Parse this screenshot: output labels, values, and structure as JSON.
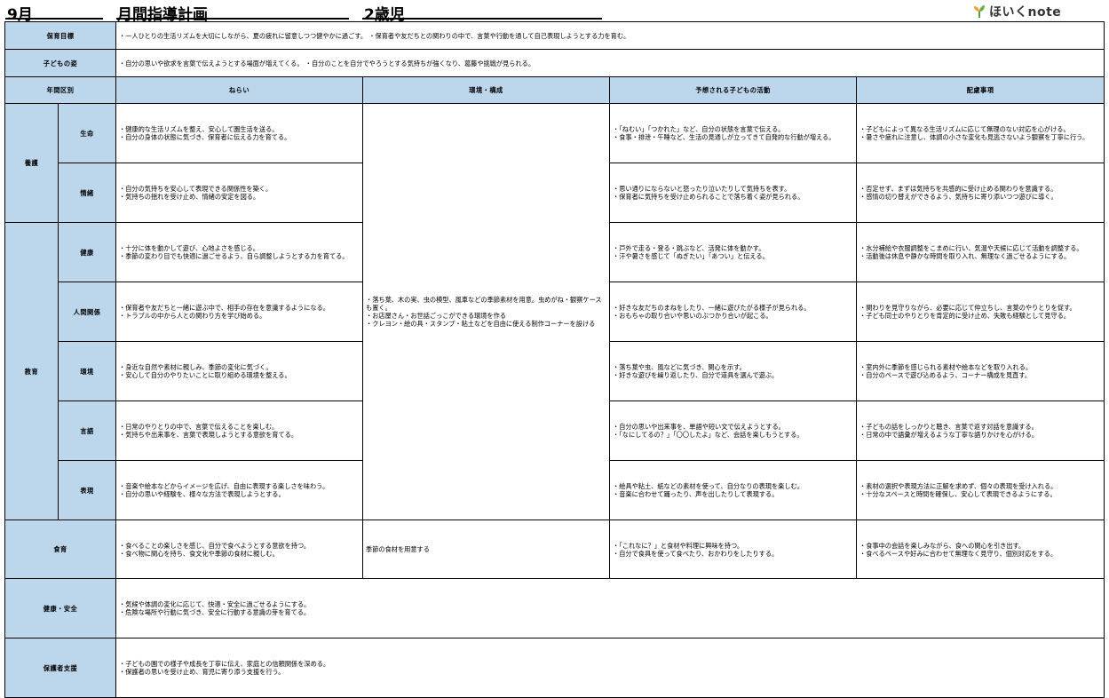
{
  "header": {
    "month": "9月",
    "title": "月間指導計画",
    "age": "2歳児",
    "logo_text": "ほいくnote"
  },
  "goal": {
    "label": "保育目標",
    "text": "・一人ひとりの生活リズムを大切にしながら、夏の疲れに留意しつつ健やかに過ごす。 ・保育者や友だちとの関わりの中で、言葉や行動を通して自己表現しようとする力を育む。"
  },
  "child": {
    "label": "子どもの姿",
    "text": "・自分の思いや欲求を言葉で伝えようとする場面が増えてくる。 ・自分のことを自分でやろうとする気持ちが強くなり、葛藤や挑戦が見られる。"
  },
  "columns": {
    "period": "年間区別",
    "aim": "ねらい",
    "env": "環境・構成",
    "activity": "予想される子どもの活動",
    "care": "配慮事項"
  },
  "groups": {
    "yogo": "養護",
    "kyoiku": "教育"
  },
  "environment_text": [
    "・落ち葉、木の実、虫の模型、風車などの季節素材を用意。虫めがね・観察ケースも置く。",
    "・お店屋さん・お世話ごっこができる環境を作る",
    "・クレヨン・絵の具・スタンプ・粘土などを自由に使える制作コーナーを設ける"
  ],
  "rows": [
    {
      "label": "生命",
      "aim": [
        "・健康的な生活リズムを整え、安心して園生活を送る。",
        "・自分の身体の状態に気づき、保育者に伝える力を育てる。"
      ],
      "activity": [
        "・「ねむい」「つかれた」など、自分の状態を言葉で伝える。",
        "・食事・排泄・午睡など、生活の見通しが立ってきて自発的な行動が増える。"
      ],
      "care": [
        "・子どもによって異なる生活リズムに応じて無理のない対応を心がける。",
        "・暑さや疲れに注意し、体調の小さな変化も見逃さないよう観察を丁寧に行う。"
      ]
    },
    {
      "label": "情緒",
      "aim": [
        "・自分の気持ちを安心して表現できる関係性を築く。",
        "・気持ちの揺れを受け止め、情緒の安定を図る。"
      ],
      "activity": [
        "・思い通りにならないと怒ったり泣いたりして気持ちを表す。",
        "・保育者に気持ちを受け止められることで落ち着く姿が見られる。"
      ],
      "care": [
        "・否定せず、まずは気持ちを共感的に受け止める関わりを意識する。",
        "・感情の切り替えができるよう、気持ちに寄り添いつつ遊びに導く。"
      ]
    },
    {
      "label": "健康",
      "aim": [
        "・十分に体を動かして遊び、心地よさを感じる。",
        "・季節の変わり目でも快適に過ごせるよう、自ら調整しようとする力を育てる。"
      ],
      "activity": [
        "・戸外で走る・登る・跳ぶなど、活発に体を動かす。",
        "・汗や暑さを感じて「ぬぎたい」「あつい」と伝える。"
      ],
      "care": [
        "・水分補給や衣服調整をこまめに行い、気温や天候に応じて活動を調整する。",
        "・活動後は休息や静かな時間を取り入れ、無理なく過ごせるようにする。"
      ]
    },
    {
      "label": "人間関係",
      "aim": [
        "・保育者や友だちと一緒に遊ぶ中で、相手の存在を意識するようになる。",
        "・トラブルの中から人との関わり方を学び始める。"
      ],
      "activity": [
        "・好きな友だちのまねをしたり、一緒に遊びたがる様子が見られる。",
        "・おもちゃの取り合いや思いのぶつかり合いが起こる。"
      ],
      "care": [
        "・関わりを見守りながら、必要に応じて仲立ちし、言葉のやりとりを促す。",
        "・子ども同士のやりとりを肯定的に受け止め、失敗も経験として見守る。"
      ]
    },
    {
      "label": "環境",
      "aim": [
        "・身近な自然や素材に親しみ、季節の変化に気づく。",
        "・安心して自分のやりたいことに取り組める環境を整える。"
      ],
      "activity": [
        "・落ち葉や虫、風などに気づき、関心を示す。",
        "・好きな遊びを繰り返したり、自分で道具を選んで遊ぶ。"
      ],
      "care": [
        "・室内外に季節を感じられる素材や絵本などを取り入れる。",
        "・自分のペースで遊び込めるよう、コーナー構成を見直す。"
      ]
    },
    {
      "label": "言語",
      "aim": [
        "・日常のやりとりの中で、言葉で伝えることを楽しむ。",
        "・気持ちや出来事を、言葉で表現しようとする意欲を育てる。"
      ],
      "activity": [
        "・自分の思いや出来事を、単語や短い文で伝えようとする。",
        "・「なにしてるの？」「〇〇したよ」など、会話を楽しもうとする。"
      ],
      "care": [
        "・子どもの話をしっかりと聴き、言葉で返す対話を意識する。",
        "・日常の中で語彙が増えるような丁寧な語りかけを心がける。"
      ]
    },
    {
      "label": "表現",
      "aim": [
        "・音楽や絵本などからイメージを広げ、自由に表現する楽しさを味わう。",
        "・自分の思いや経験を、様々な方法で表現しようとする。"
      ],
      "activity": [
        "・絵具や粘土、紙などの素材を使って、自分なりの表現を楽しむ。",
        "・音楽に合わせて踊ったり、声を出したりして表現する。"
      ],
      "care": [
        "・素材の選択や表現方法に正解を求めず、個々の表現を受け入れる。",
        "・十分なスペースと時間を確保し、安心して表現できるようにする。"
      ]
    }
  ],
  "food": {
    "label": "食育",
    "aim": [
      "・食べることの楽しさを感じ、自分で食べようとする意欲を持つ。",
      "・食べ物に関心を持ち、食文化や季節の食材に親しむ。"
    ],
    "env": "季節の食材を用意する",
    "activity": [
      "・「これなに？」と食材や料理に興味を持つ。",
      "・自分で食具を使って食べたり、おかわりをしたりする。"
    ],
    "care": [
      "・食事中の会話を楽しみながら、食への関心を引き出す。",
      "・食べるペースや好みに合わせて無理なく見守り、個別対応をする。"
    ]
  },
  "safety": {
    "label": "健康・安全",
    "text": [
      "・気候や体調の変化に応じて、快適・安全に過ごせるようにする。",
      "・危険な場所や行動に気づき、安全に行動する意識の芽を育てる。"
    ]
  },
  "support": {
    "label": "保護者支援",
    "text": [
      "・子どもの園での様子や成長を丁寧に伝え、家庭との信頼関係を深める。",
      "・保護者の思いを受け止め、育児に寄り添う支援を行う。"
    ]
  }
}
